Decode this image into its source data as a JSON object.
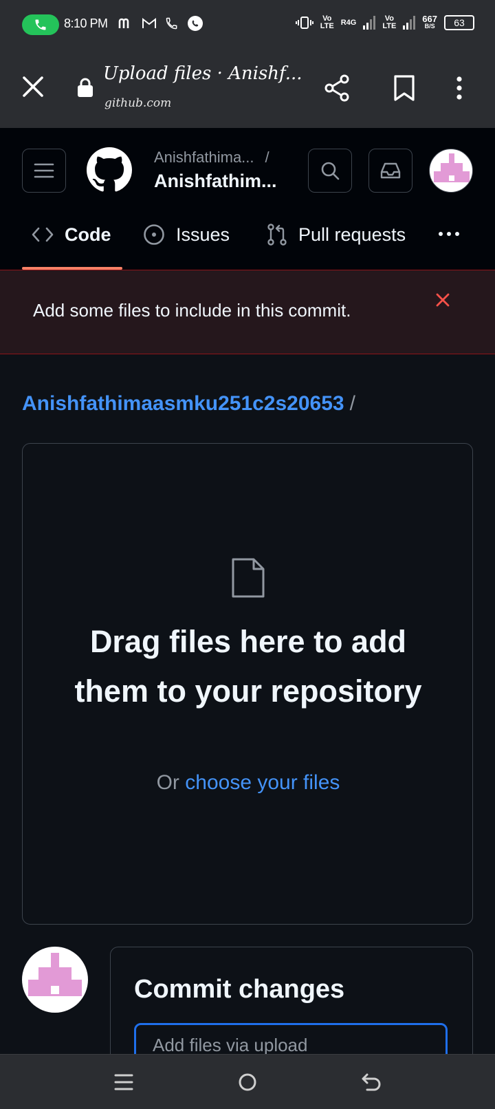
{
  "status_bar": {
    "time": "8:10 PM",
    "net_speed": "667",
    "net_unit": "B/S",
    "battery": "63",
    "net1_top": "Vo",
    "net1_bottom": "LTE",
    "net2_top": "R4G",
    "net3_top": "Vo",
    "net3_bottom": "LTE"
  },
  "browser": {
    "title": "Upload files · Anishf...",
    "url": "github.com"
  },
  "header": {
    "repo_owner": "Anishfathima...",
    "owner_separator": "/",
    "repo_name": "Anishfathim..."
  },
  "tabs": [
    {
      "label": "Code",
      "icon": "code-icon",
      "active": true
    },
    {
      "label": "Issues",
      "icon": "issue-icon"
    },
    {
      "label": "Pull requests",
      "icon": "pull-request-icon"
    }
  ],
  "flash": {
    "message": "Add some files to include in this commit."
  },
  "breadcrumb": {
    "repo": "Anishfathimaasmku251c2s20653",
    "separator": "/"
  },
  "drop_zone": {
    "title": "Drag files here to add them to your repository",
    "or_text": "Or",
    "choose_link": "choose your files"
  },
  "commit": {
    "title": "Commit changes",
    "input_placeholder": "Add files via upload"
  },
  "colors": {
    "accent_link": "#4493f8",
    "tab_underline": "#f78166",
    "flash_border": "#8e1519",
    "close_red": "#f85149",
    "call_green": "#24c35a",
    "avatar_pink": "#e29ad6"
  }
}
